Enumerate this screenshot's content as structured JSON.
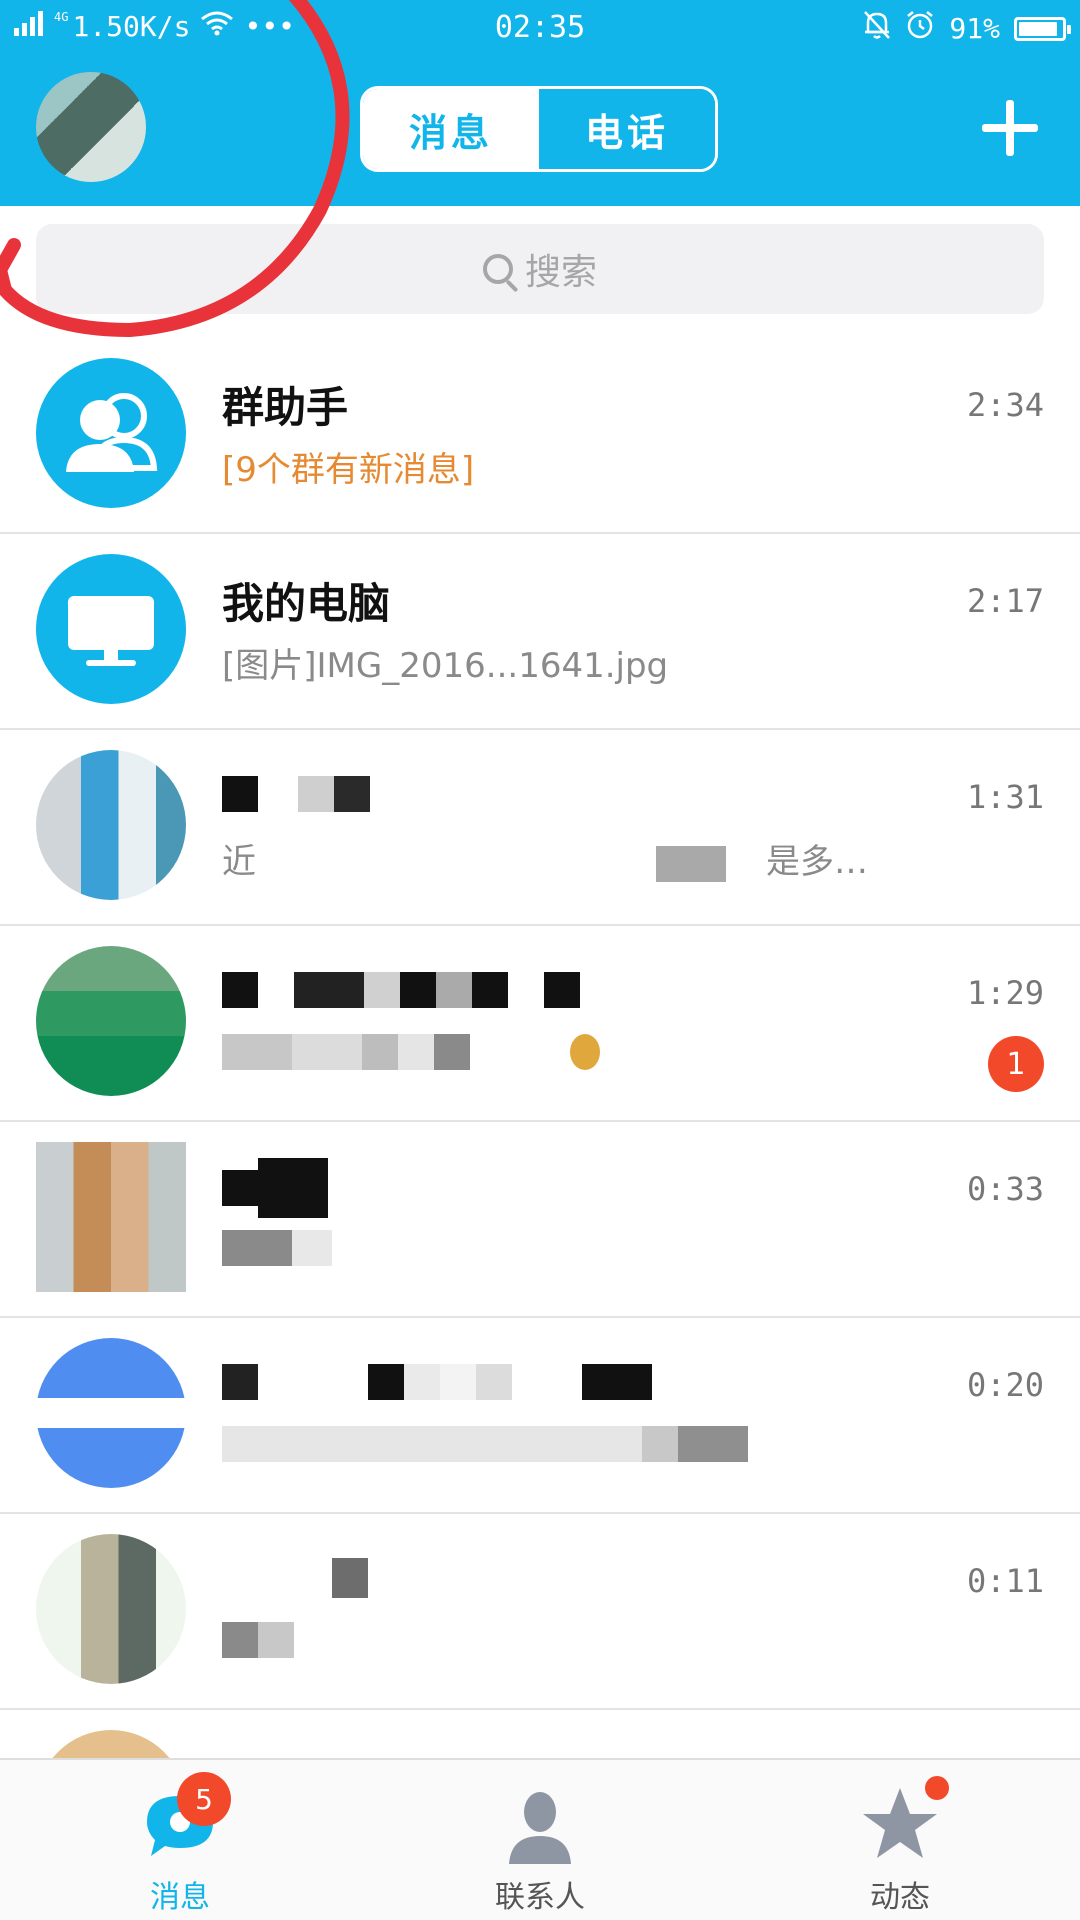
{
  "status_bar": {
    "network_type": "4G",
    "speed": "1.50K/s",
    "more": "•••",
    "time": "02:35",
    "battery_percent": "91%",
    "battery_level": 0.91
  },
  "header": {
    "tabs": [
      {
        "label": "消息",
        "active": true
      },
      {
        "label": "电话",
        "active": false
      }
    ]
  },
  "search": {
    "placeholder": "搜索"
  },
  "conversations": [
    {
      "name": "群助手",
      "preview": "[9个群有新消息]",
      "time": "2:34",
      "unread": null,
      "avatar": "group-assistant-icon"
    },
    {
      "name": "我的电脑",
      "preview": "[图片]IMG_2016...1641.jpg",
      "time": "2:17",
      "unread": null,
      "avatar": "computer-icon"
    },
    {
      "name": "",
      "preview": "近",
      "preview_tail": "是多…",
      "time": "1:31",
      "unread": null,
      "avatar": "blurred-avatar"
    },
    {
      "name": "",
      "preview": "",
      "time": "1:29",
      "unread": "1",
      "avatar": "blurred-avatar"
    },
    {
      "name": "",
      "preview": "",
      "time": "0:33",
      "unread": null,
      "avatar": "blurred-avatar"
    },
    {
      "name": "",
      "preview": "",
      "time": "0:20",
      "unread": null,
      "avatar": "blurred-avatar"
    },
    {
      "name": "",
      "preview": "",
      "time": "0:11",
      "unread": null,
      "avatar": "blurred-avatar"
    }
  ],
  "tabbar": {
    "items": [
      {
        "label": "消息",
        "badge": "5",
        "icon": "message-bubble-icon",
        "active": true
      },
      {
        "label": "联系人",
        "badge": null,
        "icon": "contact-person-icon",
        "active": false
      },
      {
        "label": "动态",
        "badge": "dot",
        "icon": "star-icon",
        "active": false
      }
    ]
  },
  "colors": {
    "brand": "#12b5ea",
    "badge": "#f2492b",
    "highlight_text": "#e58a32",
    "annotation": "#e8333b"
  }
}
